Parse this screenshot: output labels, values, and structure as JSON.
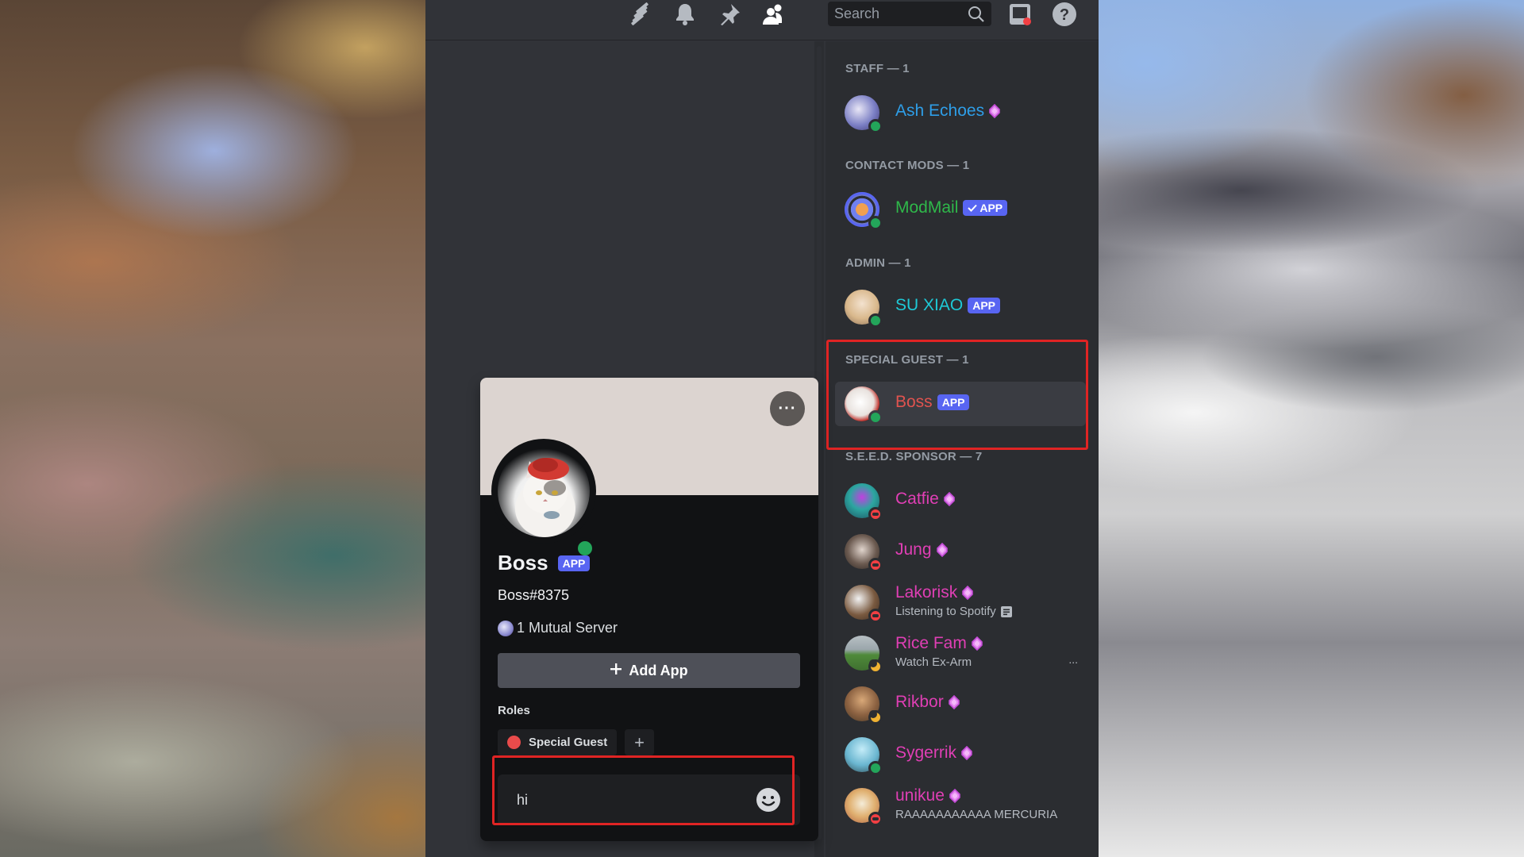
{
  "header": {
    "icons": [
      {
        "name": "threads-icon",
        "label": "Threads"
      },
      {
        "name": "bell-icon",
        "label": "Notification Settings"
      },
      {
        "name": "pin-icon",
        "label": "Pinned Messages"
      },
      {
        "name": "members-icon",
        "label": "Member List",
        "active": true
      }
    ],
    "search_placeholder": "Search",
    "inbox_label": "Inbox",
    "help_label": "Help"
  },
  "members": {
    "sections": [
      {
        "title": "STAFF — 1",
        "members": [
          {
            "name": "Ash Echoes",
            "color": "#2e9ee8",
            "status": "online",
            "badge": "gem"
          }
        ]
      },
      {
        "title": "CONTACT MODS — 1",
        "members": [
          {
            "name": "ModMail",
            "color": "#2fb84a",
            "status": "online",
            "badge": "app",
            "verified": true,
            "badge_label": "APP"
          }
        ]
      },
      {
        "title": "ADMIN — 1",
        "members": [
          {
            "name": "SU XIAO",
            "color": "#1ec9d6",
            "status": "online",
            "badge": "app",
            "badge_label": "APP"
          }
        ]
      },
      {
        "title": "SPECIAL GUEST — 1",
        "highlighted": true,
        "members": [
          {
            "name": "Boss",
            "color": "#e0534f",
            "status": "online",
            "badge": "app",
            "badge_label": "APP",
            "selected": true
          }
        ]
      },
      {
        "title": "S.E.E.D. SPONSOR — 7",
        "members": [
          {
            "name": "Catfie",
            "color": "#e03fb5",
            "status": "dnd",
            "badge": "gem"
          },
          {
            "name": "Jung",
            "color": "#e03fb5",
            "status": "dnd",
            "badge": "gem"
          },
          {
            "name": "Lakorisk",
            "color": "#e03fb5",
            "status": "dnd",
            "badge": "gem",
            "activity": "Listening to Spotify",
            "activity_icon": "rich-presence-icon"
          },
          {
            "name": "Rice Fam",
            "color": "#e03fb5",
            "status": "idle",
            "badge": "gem",
            "activity": "Watch Ex-Arm",
            "more": "..."
          },
          {
            "name": "Rikbor",
            "color": "#e03fb5",
            "status": "idle",
            "badge": "gem"
          },
          {
            "name": "Sygerrik",
            "color": "#e03fb5",
            "status": "online",
            "badge": "gem"
          },
          {
            "name": "unikue",
            "color": "#e03fb5",
            "status": "dnd",
            "badge": "gem",
            "activity": "RAAAAAAAAAAA MERCURIA"
          }
        ]
      }
    ]
  },
  "profile": {
    "display_name": "Boss",
    "badge_label": "APP",
    "username": "Boss#8375",
    "mutual_servers": "1 Mutual Server",
    "add_app_label": "Add App",
    "roles_label": "Roles",
    "roles": [
      {
        "name": "Special Guest",
        "color": "#e94b4b"
      }
    ],
    "message_value": "hi",
    "status": "online"
  },
  "colors": {
    "accent": "#5865f2",
    "online": "#23a55a",
    "dnd": "#f23f43",
    "idle": "#f0b232",
    "highlight": "#e02424"
  }
}
